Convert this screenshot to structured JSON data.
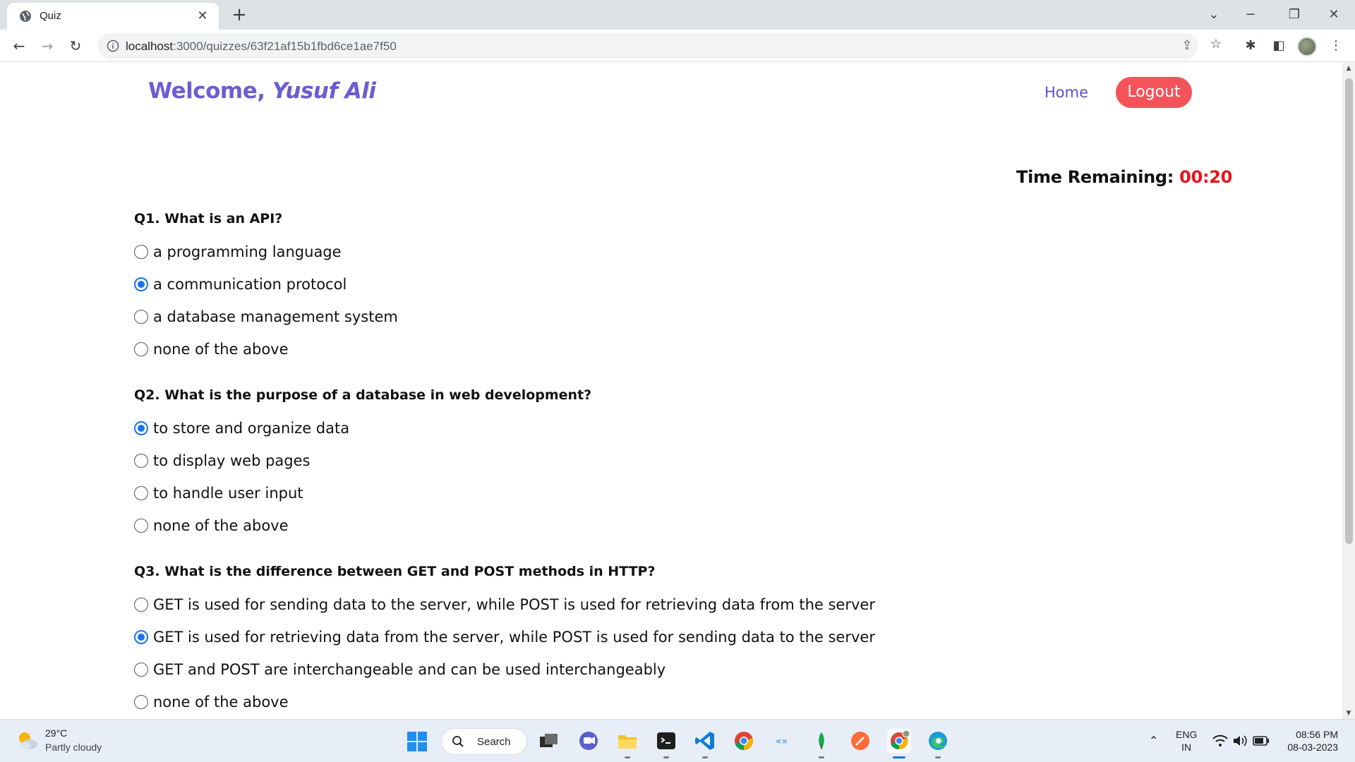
{
  "browser": {
    "tab_title": "Quiz",
    "url_host": "localhost",
    "url_rest": ":3000/quizzes/63f21af15b1fbd6ce1ae7f50"
  },
  "header": {
    "welcome_prefix": "Welcome,",
    "user_name": "Yusuf Ali",
    "home_label": "Home",
    "logout_label": "Logout"
  },
  "timer": {
    "label": "Time Remaining:",
    "value": "00:20"
  },
  "questions": [
    {
      "text": "Q1. What is an API?",
      "options": [
        {
          "label": "a programming language",
          "checked": false
        },
        {
          "label": "a communication protocol",
          "checked": true
        },
        {
          "label": "a database management system",
          "checked": false
        },
        {
          "label": "none of the above",
          "checked": false
        }
      ]
    },
    {
      "text": "Q2. What is the purpose of a database in web development?",
      "options": [
        {
          "label": "to store and organize data",
          "checked": true
        },
        {
          "label": "to display web pages",
          "checked": false
        },
        {
          "label": "to handle user input",
          "checked": false
        },
        {
          "label": "none of the above",
          "checked": false
        }
      ]
    },
    {
      "text": "Q3. What is the difference between GET and POST methods in HTTP?",
      "options": [
        {
          "label": "GET is used for sending data to the server, while POST is used for retrieving data from the server",
          "checked": false
        },
        {
          "label": "GET is used for retrieving data from the server, while POST is used for sending data to the server",
          "checked": true
        },
        {
          "label": "GET and POST are interchangeable and can be used interchangeably",
          "checked": false
        },
        {
          "label": "none of the above",
          "checked": false
        }
      ]
    }
  ],
  "taskbar": {
    "weather_temp": "29°C",
    "weather_desc": "Partly cloudy",
    "search_label": "Search",
    "lang_top": "ENG",
    "lang_bottom": "IN",
    "time": "08:56 PM",
    "date": "08-03-2023"
  },
  "colors": {
    "accent": "#6c5dd3",
    "logout_bg": "#f4535a",
    "timer_value": "#e8141c",
    "radio_checked": "#1a73e8"
  }
}
